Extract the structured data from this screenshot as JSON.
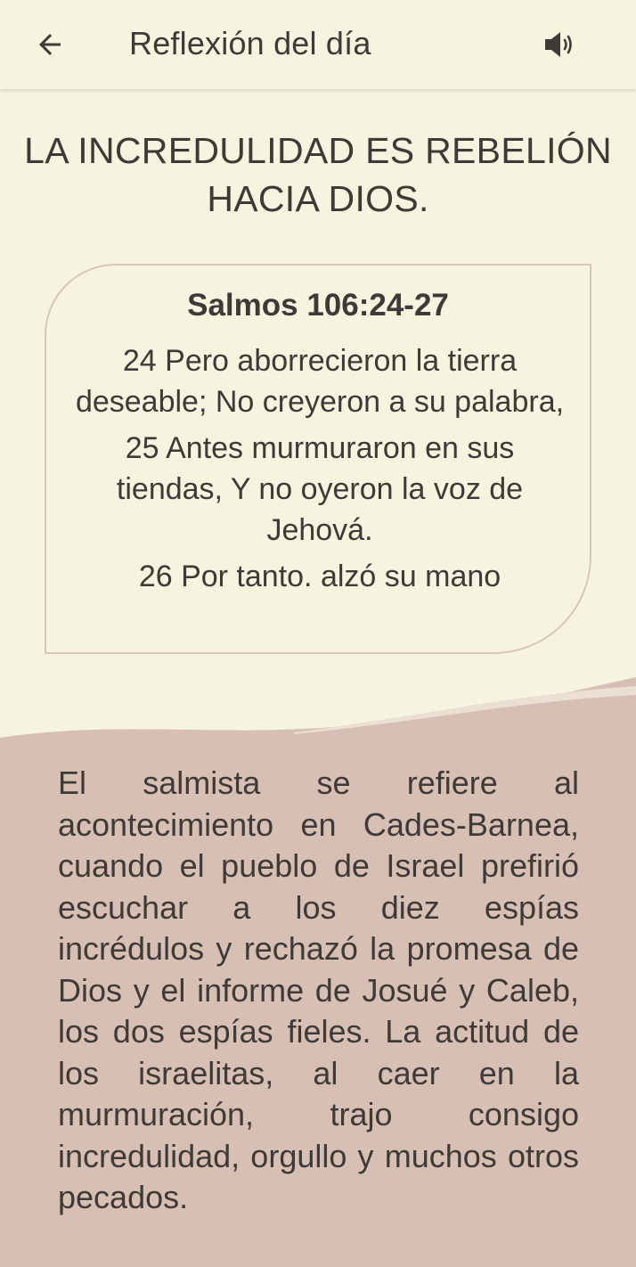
{
  "header": {
    "title": "Reflexión del día",
    "back_icon": "arrow-left-icon",
    "sound_icon": "volume-icon"
  },
  "headline": "LA INCREDULIDAD ES REBELIÓN HACIA DIOS.",
  "verse_card": {
    "reference": "Salmos 106:24-27",
    "verses": [
      "24 Pero aborrecieron la tierra deseable; No creyeron a su palabra,",
      "25 Antes murmuraron en sus tiendas, Y no oyeron la voz de Jehová.",
      "26 Por tanto. alzó su mano"
    ]
  },
  "reflection": "El salmista se refiere al acontecimiento en Cades-Barnea, cuando el pueblo de Israel prefirió escuchar a los diez espías incrédulos y rechazó la promesa de Dios y el informe de Josué y Caleb, los dos espías fieles. La actitud de los israelitas, al caer en la murmuración, trajo consigo incredulidad, orgullo y muchos otros pecados.",
  "colors": {
    "background": "#f6f3df",
    "bottom_panel": "#d8bfb3",
    "card_border": "#d9c6b8",
    "text": "#3e3a37"
  }
}
